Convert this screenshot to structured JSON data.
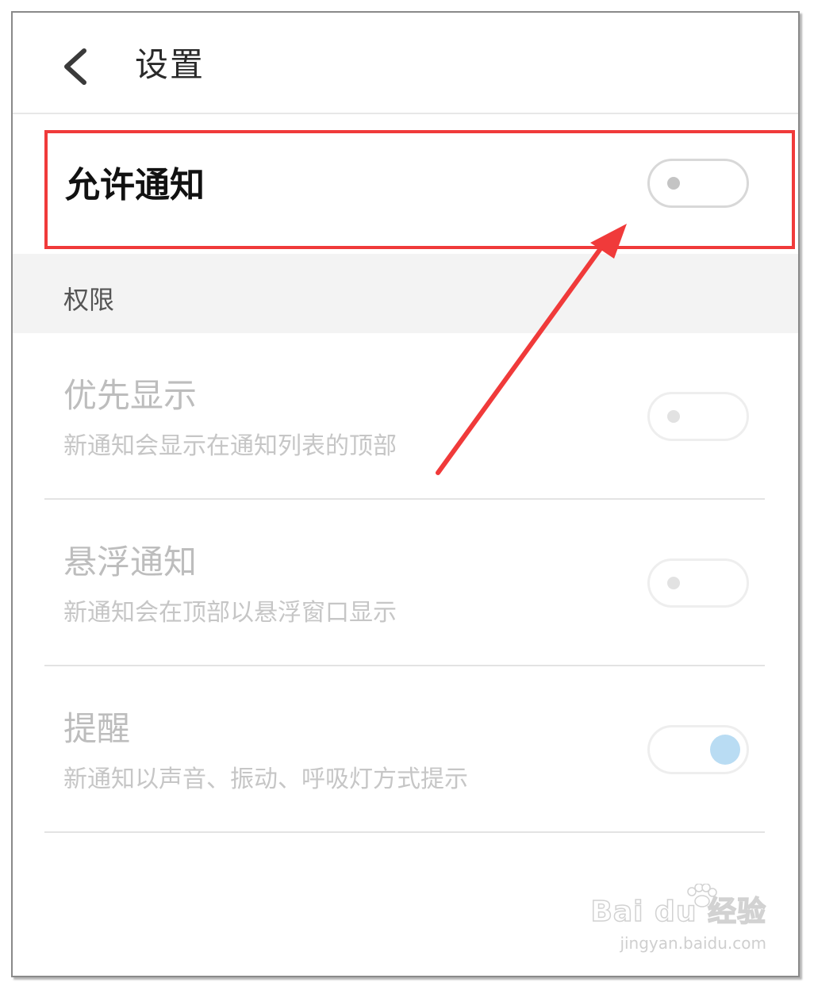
{
  "header": {
    "title": "设置",
    "back_icon": "chevron-left-icon"
  },
  "allow_notifications": {
    "label": "允许通知",
    "enabled": false
  },
  "permissions_section": {
    "label": "权限",
    "items": [
      {
        "title": "优先显示",
        "description": "新通知会显示在通知列表的顶部",
        "enabled": false
      },
      {
        "title": "悬浮通知",
        "description": "新通知会在顶部以悬浮窗口显示",
        "enabled": false
      },
      {
        "title": "提醒",
        "description": "新通知以声音、振动、呼吸灯方式提示",
        "enabled": true
      }
    ]
  },
  "annotation": {
    "highlight_color": "#f03a3a"
  },
  "watermark": {
    "logo": "Bai du 经验",
    "url": "jingyan.baidu.com"
  },
  "colors": {
    "switch_on_knob": "#b9dcf3",
    "section_background": "#f3f3f3"
  }
}
